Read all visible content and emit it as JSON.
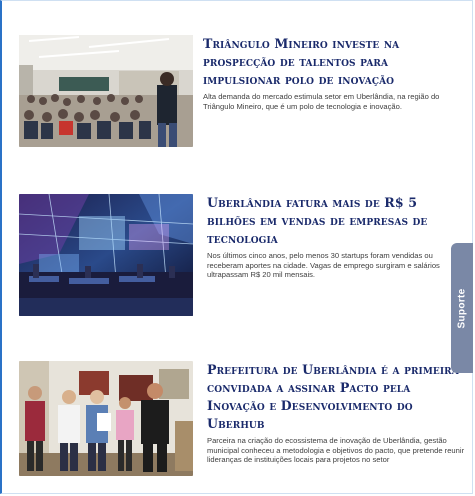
{
  "articles": [
    {
      "title": "Triângulo Mineiro investe na prospecção de talentos para impulsionar polo de inovação",
      "summary": "Alta demanda do mercado estimula setor em Uberlândia, na região do Triângulo Mineiro, que é um polo de tecnologia e inovação.",
      "image": "classroom-photo"
    },
    {
      "title": "Uberlândia fatura mais de R$ 5 bilhões em vendas de empresas de tecnologia",
      "summary": "Nos últimos cinco anos, pelo menos 30 startups foram vendidas ou receberam aportes na cidade. Vagas de emprego surgiram e salários ultrapassam R$ 20 mil mensais.",
      "image": "futuristic-office-illustration"
    },
    {
      "title": "Prefeitura de Uberlândia é a primeira convidada a assinar Pacto pela Inovação e Desenvolvimento do Uberhub",
      "summary": "Parceira na criação do ecossistema de inovação de Uberlândia, gestão municipal conheceu a metodologia e objetivos do pacto, que pretende reunir lideranças de instituições locais para projetos no setor",
      "image": "group-photo"
    }
  ],
  "support_tab": {
    "label": "Suporte"
  },
  "colors": {
    "title": "#1a2a6b",
    "support_tab": "#7a88a6",
    "frame_accent": "#2a72c7"
  }
}
